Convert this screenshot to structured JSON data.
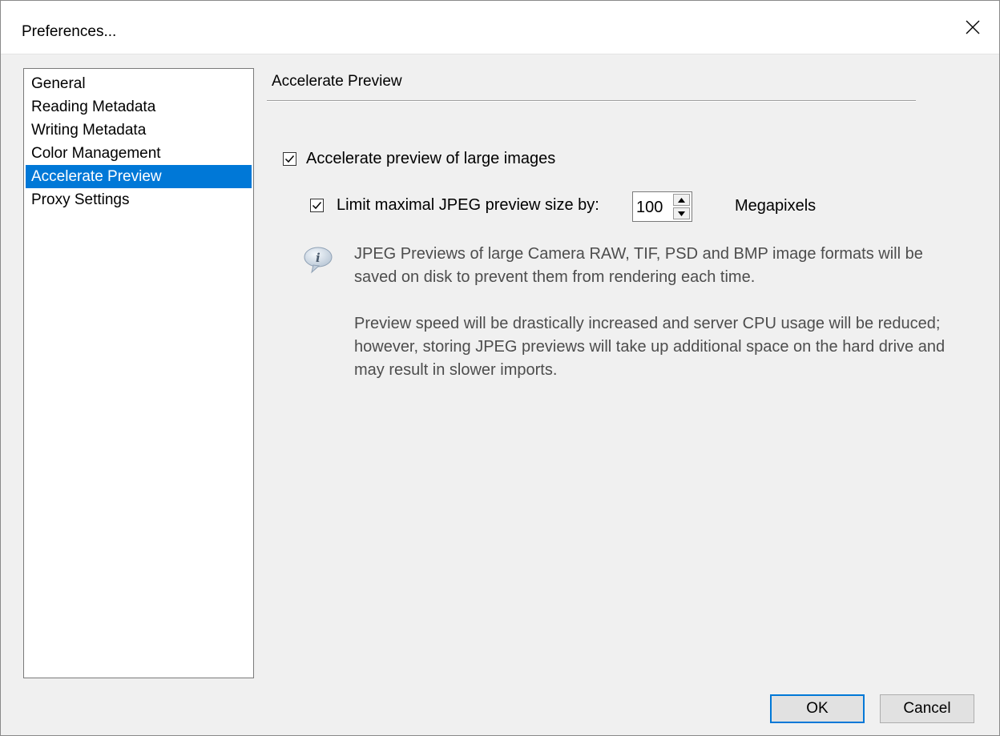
{
  "window": {
    "title": "Preferences..."
  },
  "nav": {
    "items": [
      {
        "label": "General",
        "selected": false
      },
      {
        "label": "Reading Metadata",
        "selected": false
      },
      {
        "label": "Writing Metadata",
        "selected": false
      },
      {
        "label": "Color Management",
        "selected": false
      },
      {
        "label": "Accelerate Preview",
        "selected": true
      },
      {
        "label": "Proxy Settings",
        "selected": false
      }
    ]
  },
  "panel": {
    "title": "Accelerate Preview",
    "accelerate": {
      "label": "Accelerate preview of large images",
      "checked": true
    },
    "limit": {
      "label": "Limit maximal JPEG preview size by:",
      "checked": true,
      "value": "100",
      "unit": "Megapixels"
    },
    "info": {
      "icon": "info-icon",
      "paragraph1": "JPEG Previews of large Camera RAW, TIF, PSD and BMP image formats will be saved on disk to prevent them from rendering each time.",
      "paragraph2": "Preview speed will be drastically increased and server CPU usage will be reduced; however, storing JPEG previews will take up additional space on the hard drive and may result in slower imports."
    }
  },
  "buttons": {
    "ok": "OK",
    "cancel": "Cancel"
  },
  "colors": {
    "selection": "#0078d7",
    "background": "#f0f0f0",
    "info_text": "#4d4d4d"
  }
}
